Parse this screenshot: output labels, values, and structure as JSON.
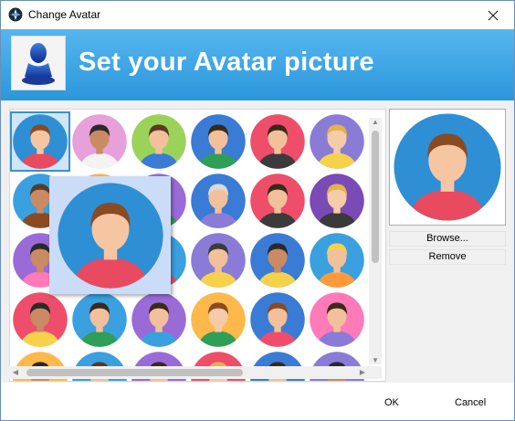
{
  "window": {
    "title": "Change Avatar"
  },
  "header": {
    "title": "Set your Avatar picture"
  },
  "buttons": {
    "browse": "Browse...",
    "remove": "Remove",
    "ok": "OK",
    "cancel": "Cancel"
  },
  "icons": {
    "app": "app-logo-icon",
    "close": "close-icon",
    "header": "user-avatar-icon"
  },
  "colors": {
    "header_top": "#56b6ef",
    "header_bottom": "#2b97db",
    "selection": "#3c8fc8"
  },
  "gallery": {
    "selected_index": 0,
    "avatars": [
      {
        "bg": "#2f8fd5",
        "skin": "#f6c6a2",
        "hair": "#8a4a22",
        "shirt": "#e84a5f"
      },
      {
        "bg": "#e7a0d9",
        "skin": "#c98a64",
        "hair": "#2a2a2a",
        "shirt": "#f3f3f3"
      },
      {
        "bg": "#9bd35a",
        "skin": "#f2c09a",
        "hair": "#5b3a23",
        "shirt": "#3a7bd5"
      },
      {
        "bg": "#3a7bd5",
        "skin": "#f2c09a",
        "hair": "#3a2a1a",
        "shirt": "#2f9e57"
      },
      {
        "bg": "#ee4e6a",
        "skin": "#f2c09a",
        "hair": "#3a2a1a",
        "shirt": "#3b3b3b"
      },
      {
        "bg": "#8a7bd7",
        "skin": "#f5cba8",
        "hair": "#e1b34a",
        "shirt": "#f6d24a"
      },
      {
        "bg": "#3aa0e0",
        "skin": "#c98a64",
        "hair": "#5b3a23",
        "shirt": "#8a4a22"
      },
      {
        "bg": "#ffb84a",
        "skin": "#f2c09a",
        "hair": "#4a2a1a",
        "shirt": "#3a7bd5"
      },
      {
        "bg": "#9a6bd7",
        "skin": "#f2c09a",
        "hair": "#3a2a1a",
        "shirt": "#2f9e57"
      },
      {
        "bg": "#3a7bd5",
        "skin": "#f2c09a",
        "hair": "#d9d9d9",
        "shirt": "#8a7bd7"
      },
      {
        "bg": "#ee4e6a",
        "skin": "#f2c09a",
        "hair": "#3a2a1a",
        "shirt": "#3b3b3b"
      },
      {
        "bg": "#7a4ab5",
        "skin": "#f5cba8",
        "hair": "#e1b34a",
        "shirt": "#3a3a3a"
      },
      {
        "bg": "#9a6bd7",
        "skin": "#c98a64",
        "hair": "#2a2a2a",
        "shirt": "#ff7ab8"
      },
      {
        "bg": "#ffb84a",
        "skin": "#f2c09a",
        "hair": "#3a2a1a",
        "shirt": "#3a7bd5"
      },
      {
        "bg": "#3aa0e0",
        "skin": "#f2c09a",
        "hair": "#5b3a23",
        "shirt": "#ee4e6a"
      },
      {
        "bg": "#8a7bd7",
        "skin": "#f2c09a",
        "hair": "#3b3b3b",
        "shirt": "#f6d24a"
      },
      {
        "bg": "#3a7bd5",
        "skin": "#c98a64",
        "hair": "#2a2a2a",
        "shirt": "#f6d24a"
      },
      {
        "bg": "#3aa0e0",
        "skin": "#f2c09a",
        "hair": "#f6d24a",
        "shirt": "#ff9a3a"
      },
      {
        "bg": "#ee4e6a",
        "skin": "#c98a64",
        "hair": "#2a2a2a",
        "shirt": "#f6d24a"
      },
      {
        "bg": "#3aa0e0",
        "skin": "#f2c09a",
        "hair": "#3a2a1a",
        "shirt": "#2f9e57"
      },
      {
        "bg": "#9a6bd7",
        "skin": "#f2c09a",
        "hair": "#3a2a1a",
        "shirt": "#3aa0e0"
      },
      {
        "bg": "#ffb84a",
        "skin": "#f5cba8",
        "hair": "#8a4a22",
        "shirt": "#2f9e57"
      },
      {
        "bg": "#3a7bd5",
        "skin": "#f2c09a",
        "hair": "#8a4a22",
        "shirt": "#ee4e6a"
      },
      {
        "bg": "#ff7ab8",
        "skin": "#f2c09a",
        "hair": "#3a2a1a",
        "shirt": "#8a7bd7"
      },
      {
        "bg": "#ffb84a",
        "skin": "#c98a64",
        "hair": "#2a2a2a",
        "shirt": "#ee4e6a"
      },
      {
        "bg": "#3aa0e0",
        "skin": "#f2c09a",
        "hair": "#5b3a23",
        "shirt": "#3a7bd5"
      },
      {
        "bg": "#9a6bd7",
        "skin": "#f2c09a",
        "hair": "#3a2a1a",
        "shirt": "#f6d24a"
      },
      {
        "bg": "#ee4e6a",
        "skin": "#f5cba8",
        "hair": "#e1b34a",
        "shirt": "#3a7bd5"
      },
      {
        "bg": "#3a7bd5",
        "skin": "#f2c09a",
        "hair": "#3a2a1a",
        "shirt": "#ee4e6a"
      },
      {
        "bg": "#8a7bd7",
        "skin": "#c98a64",
        "hair": "#2a2a2a",
        "shirt": "#3aa0e0"
      }
    ]
  },
  "preview": {
    "bg": "#2f8fd5",
    "skin": "#f6c6a2",
    "hair": "#8a4a22",
    "shirt": "#e84a5f"
  }
}
